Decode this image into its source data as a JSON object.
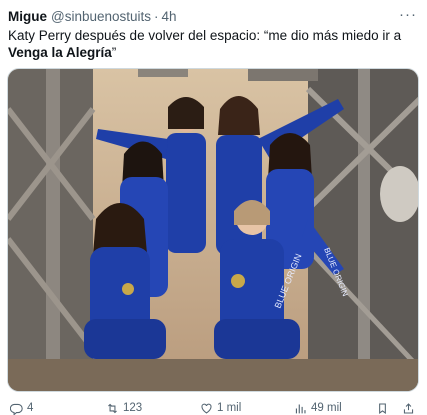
{
  "tweet": {
    "author_name": "Migue",
    "author_handle": "@sinbuenostuits",
    "separator": "·",
    "time": "4h",
    "more_label": "···",
    "text_prefix": "Katy Perry después de volver del espacio: “me dio más miedo ir a ",
    "text_bold": "Venga la Alegría",
    "text_suffix": "”"
  },
  "media": {
    "image_description": "Six women in blue flight suits posing on a metal launch tower",
    "suit_text": "BLUE ORIGIN"
  },
  "actions": {
    "replies": "4",
    "reposts": "123",
    "likes": "1 mil",
    "views": "49 mil"
  },
  "colors": {
    "text_primary": "#0f1419",
    "text_secondary": "#536471",
    "suit_blue": "#1f3fa8"
  }
}
